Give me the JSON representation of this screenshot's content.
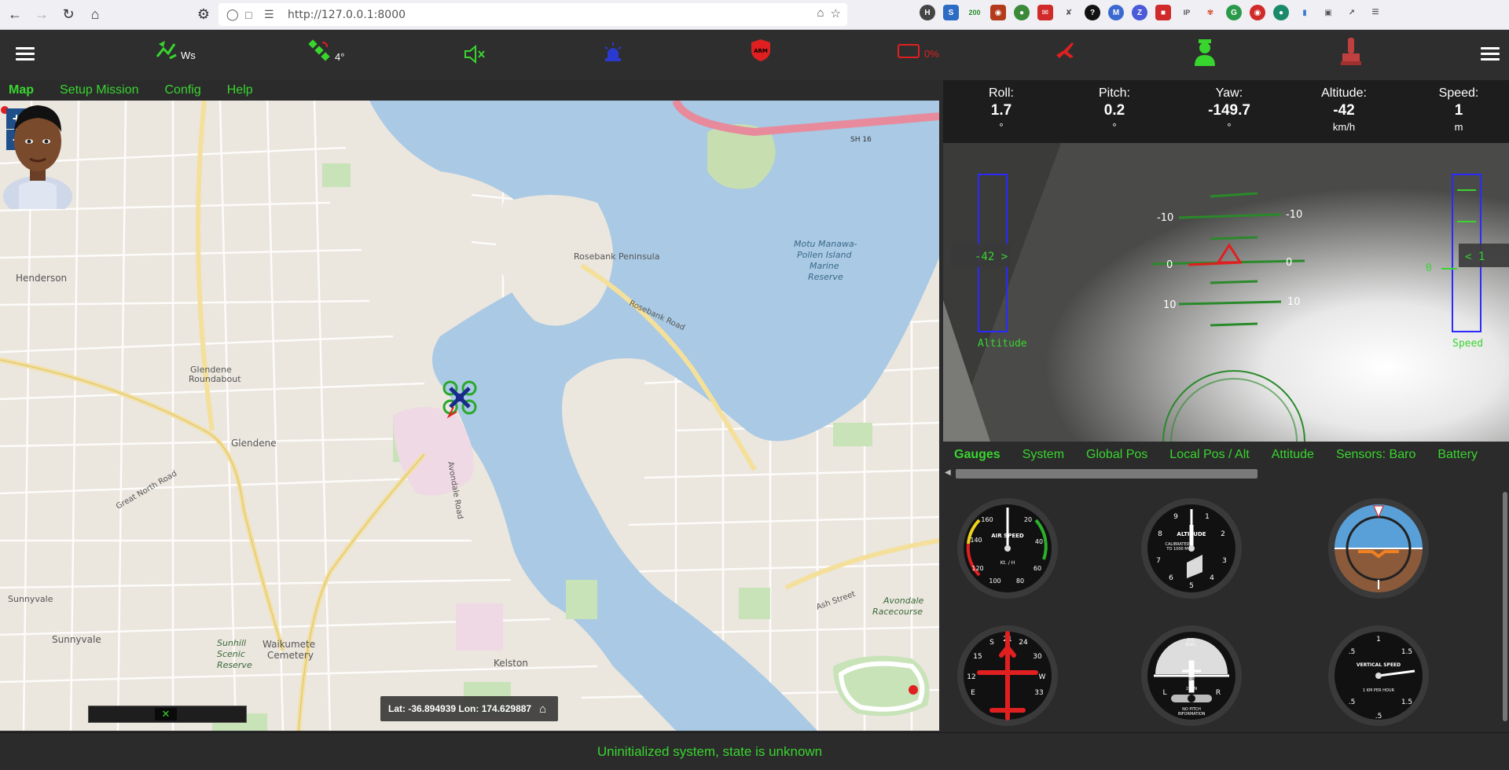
{
  "browser": {
    "url": "http://127.0.0.1:8000"
  },
  "toolbar": {
    "connection_text": "Ws",
    "satellite_text": "4°",
    "battery_text": "0%",
    "colors": {
      "accent": "#39d52f",
      "alert": "#e02020",
      "sky": "#5aa0d8",
      "ground": "#8a5a3a"
    }
  },
  "map_tabs": [
    {
      "label": "Map"
    },
    {
      "label": "Setup Mission"
    },
    {
      "label": "Config"
    },
    {
      "label": "Help"
    }
  ],
  "map": {
    "zoom_in": "+",
    "zoom_out": "−",
    "coords": "Lat: -36.894939 Lon: 174.629887",
    "labels": {
      "rosebank": "Rosebank Peninsula",
      "motu": "Motu Manawa-",
      "motu2": "Pollen Island",
      "motu3": "Marine",
      "motu4": "Reserve",
      "henderson": "Henderson",
      "glendene": "Glendene",
      "glendene_rb": "Glendene",
      "glendene_rb2": "Roundabout",
      "sunnyvale": "Sunnyvale",
      "sunnyvale2": "Sunnyvale",
      "kelston": "Kelston",
      "waikumete": "Waikumete",
      "cemetery": "Cemetery",
      "avondale": "Avondale",
      "racecourse": "Racecourse",
      "sunhill": "Sunhill",
      "scenic": "Scenic",
      "reserve": "Reserve",
      "rosebank_rd": "Rosebank Road",
      "great_north": "Great North Road",
      "avondale_rd": "Avondale Road",
      "ash": "Ash Street",
      "sh16": "SH 16"
    }
  },
  "hud": {
    "fields": [
      {
        "label": "Roll:",
        "value": "1.7",
        "unit": "°"
      },
      {
        "label": "Pitch:",
        "value": "0.2",
        "unit": "°"
      },
      {
        "label": "Yaw:",
        "value": "-149.7",
        "unit": "°"
      },
      {
        "label": "Altitude:",
        "value": "-42",
        "unit": "km/h"
      },
      {
        "label": "Speed:",
        "value": "1",
        "unit": "m"
      }
    ],
    "altitude_tag": "-42 >",
    "altitude_label": "Altitude",
    "speed_tag": "< 1",
    "speed_zero": "0",
    "speed_label": "Speed",
    "ladder": {
      "neg10": "-10",
      "zero": "0",
      "pos10": "10"
    }
  },
  "gauge_tabs": [
    {
      "label": "Gauges"
    },
    {
      "label": "System"
    },
    {
      "label": "Global Pos"
    },
    {
      "label": "Local Pos / Alt"
    },
    {
      "label": "Attitude"
    },
    {
      "label": "Sensors: Baro"
    },
    {
      "label": "Battery"
    }
  ],
  "gauges": {
    "airspeed": {
      "title": "AIR SPEED",
      "unit": "Kt. / H",
      "t160": "160",
      "t20": "20",
      "t140": "140",
      "t40": "40",
      "t120": "120",
      "t60": "60",
      "t100": "100",
      "t80": "80"
    },
    "altimeter": {
      "title": "ALTITUDE",
      "sub1": "CALIBRATED",
      "sub2": "TO 1000 M",
      "n9": "9",
      "n1": "1",
      "n8": "8",
      "n2": "2",
      "n7": "7",
      "n3": "3",
      "n6": "6",
      "n4": "4",
      "n5": "5"
    },
    "heading": {
      "n21": "21",
      "nS": "S",
      "n24": "24",
      "n15": "15",
      "n30": "30",
      "n12": "12",
      "nE": "E",
      "n33": "33",
      "nW": "W"
    },
    "turn": {
      "top1": "D.C.",
      "top2": "ELEC.",
      "mid": "TURN COORDINATOR",
      "min": "2 MIN",
      "bot1": "NO PITCH",
      "bot2": "INFORMATION",
      "L": "L",
      "R": "R"
    },
    "vspeed": {
      "title": "VERTICAL SPEED",
      "sub": "1 KM PER HOUR",
      "t5a": ".5",
      "t5b": ".5",
      "t1": "1",
      "t15a": "1.5",
      "t15b": "1.5",
      "t5c": ".5"
    }
  },
  "status": {
    "text": "Uninitialized system, state is unknown"
  }
}
